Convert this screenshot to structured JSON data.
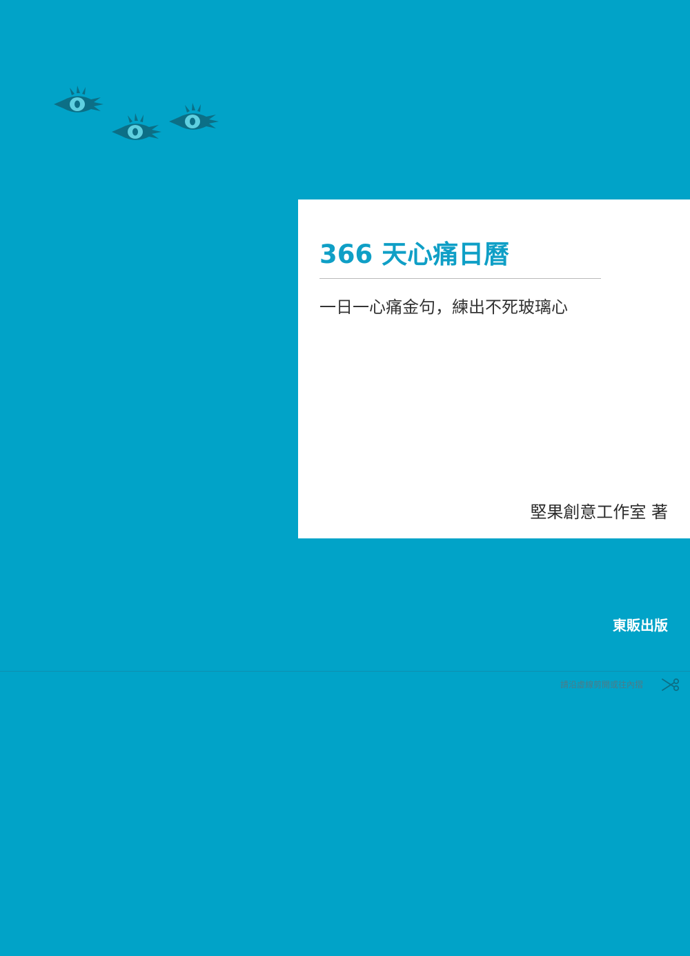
{
  "cover": {
    "title": "366 天心痛日曆",
    "subtitle": "一日一心痛金句，練出不死玻璃心",
    "author": "堅果創意工作室 著",
    "publisher": "東販出版",
    "cut_note": "請沿虛線剪開或往內摺"
  },
  "icons": {
    "decoration": [
      "eye-icon",
      "eye-icon",
      "eye-icon"
    ],
    "cut": "scissors-icon"
  },
  "colors": {
    "background": "#01a3c8",
    "panel": "#ffffff",
    "title": "#0f9fc6",
    "eye_body": "#0c6f86",
    "eye_iris": "#5fd0e0"
  }
}
